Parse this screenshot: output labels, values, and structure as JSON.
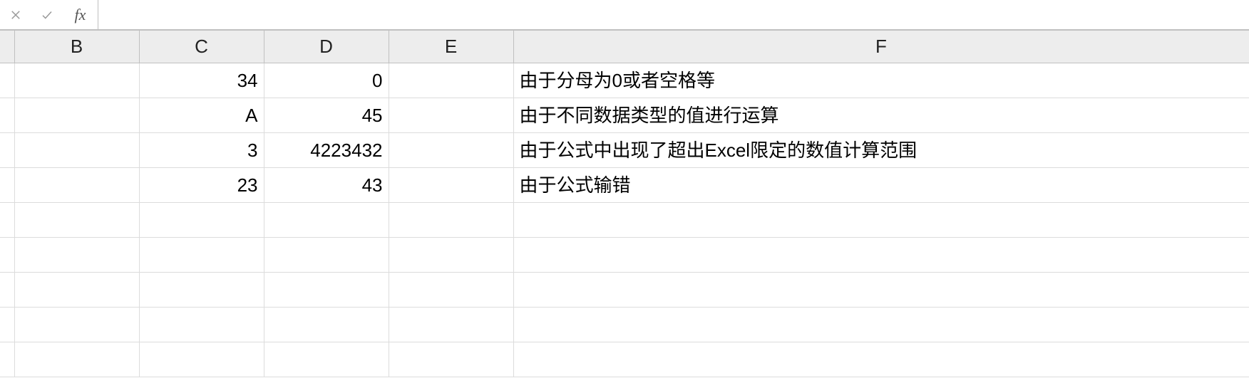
{
  "formula_bar": {
    "fx_label": "fx",
    "input_value": ""
  },
  "columns": [
    "B",
    "C",
    "D",
    "E",
    "F"
  ],
  "rows": [
    {
      "C": "34",
      "D": "0",
      "F": "由于分母为0或者空格等"
    },
    {
      "C": "A",
      "D": "45",
      "F": "由于不同数据类型的值进行运算"
    },
    {
      "C": "3",
      "D": "4223432",
      "F": "由于公式中出现了超出Excel限定的数值计算范围"
    },
    {
      "C": "23",
      "D": "43",
      "F": "由于公式输错"
    }
  ]
}
